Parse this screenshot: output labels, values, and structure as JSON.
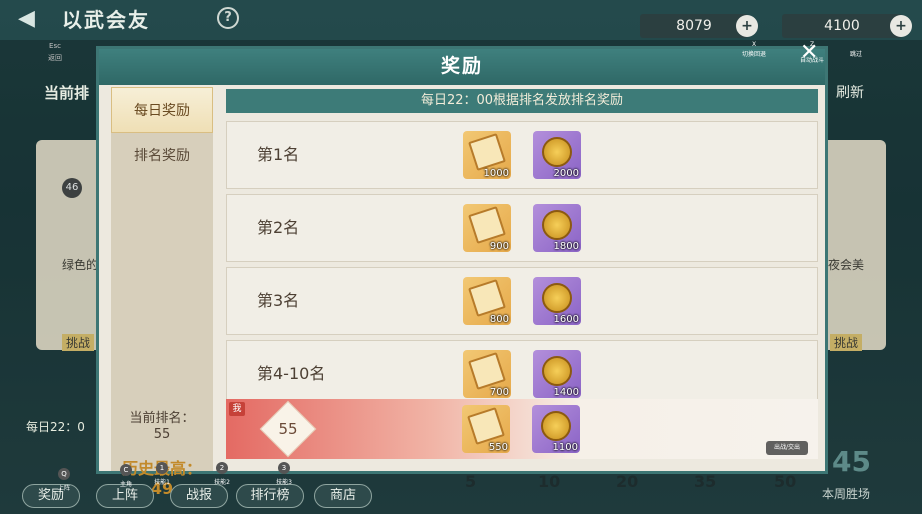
{
  "topbar": {
    "title": "以武会友",
    "help": "?",
    "ticket_count": "8079",
    "coin_count": "4100",
    "plus": "+"
  },
  "hints": {
    "esc_key": "Esc",
    "esc_label": "返回",
    "x_key": "X",
    "x_label": "切换回退",
    "z_key": "Z",
    "z_label": "自动战斗",
    "skip": "跳过",
    "q_key": "Q",
    "q_label": "上阵",
    "c_key": "C",
    "c_label": "主角",
    "k1": "1",
    "k1_label": "技能1",
    "k2": "2",
    "k2_label": "技能2",
    "k3": "3",
    "k3_label": "技能3",
    "switch_label": "切换",
    "switch_sub": "出战/交出"
  },
  "modal": {
    "title": "奖励",
    "tabs": [
      "每日奖励",
      "排名奖励"
    ],
    "banner": "每日22：00根据排名发放排名奖励",
    "rows": [
      {
        "rank": "第1名",
        "ticket": "1000",
        "coin": "2000"
      },
      {
        "rank": "第2名",
        "ticket": "900",
        "coin": "1800"
      },
      {
        "rank": "第3名",
        "ticket": "800",
        "coin": "1600"
      },
      {
        "rank": "第4-10名",
        "ticket": "700",
        "coin": "1400"
      }
    ],
    "me": {
      "tag": "我",
      "rank": "55",
      "ticket": "550",
      "coin": "1100"
    },
    "current_rank_label": "当前排名：",
    "current_rank_value": "55",
    "best_label": "历史最高：",
    "best_value": "49"
  },
  "background": {
    "current_rank_partial": "当前排",
    "refresh_partial": "刷新",
    "left_name": "绿色的",
    "right_name": "夜会美",
    "left_level": "46",
    "challenge": "挑战",
    "daily_note": "每日22：0"
  },
  "bottombar": {
    "buttons": [
      "奖励",
      "上阵",
      "战报",
      "排行榜",
      "商店"
    ],
    "ticks": [
      "5",
      "10",
      "20",
      "35",
      "50"
    ],
    "week_num": "45",
    "week_label": "本周胜场"
  }
}
